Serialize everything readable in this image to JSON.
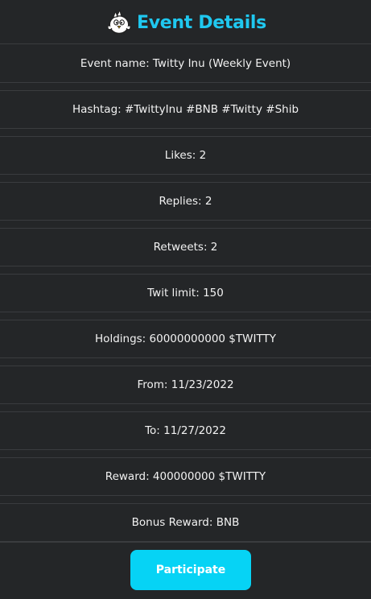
{
  "header": {
    "title": "Event Details",
    "logo_icon": "bird-mascot-icon",
    "accent_color": "#1fc8f0"
  },
  "details": [
    {
      "text": "Event name: Twitty Inu (Weekly Event)"
    },
    {
      "text": "Hashtag: #TwittyInu #BNB #Twitty #Shib"
    },
    {
      "text": "Likes: 2"
    },
    {
      "text": "Replies: 2"
    },
    {
      "text": "Retweets: 2"
    },
    {
      "text": "Twit limit: 150"
    },
    {
      "text": "Holdings: 60000000000 $TWITTY"
    },
    {
      "text": "From: 11/23/2022"
    },
    {
      "text": "To: 11/27/2022"
    },
    {
      "text": "Reward: 400000000 $TWITTY"
    },
    {
      "text": "Bonus Reward: BNB"
    }
  ],
  "actions": {
    "participate_label": "Participate",
    "button_color": "#06d3f5"
  }
}
